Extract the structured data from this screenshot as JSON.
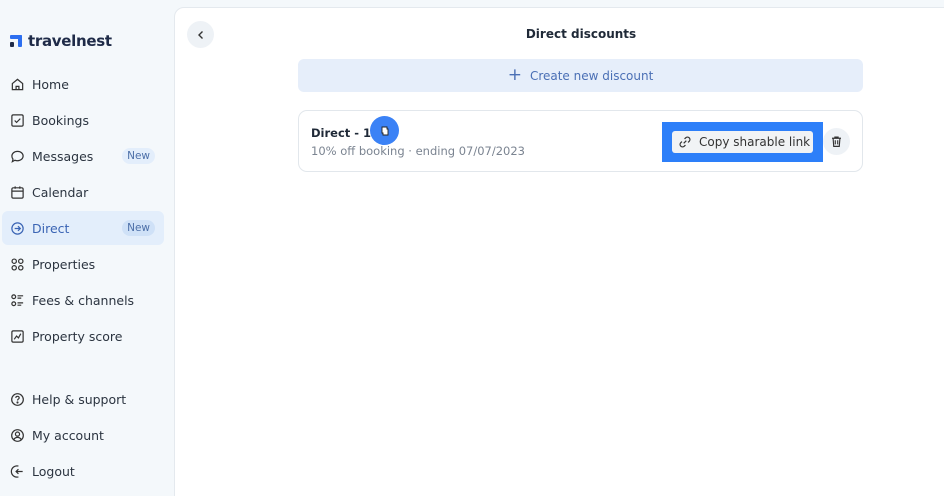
{
  "app": {
    "logo_text": "travelnest",
    "brand_color": "#1f2b48",
    "accent_color": "#3a64b4"
  },
  "sidebar": {
    "items": [
      {
        "label": "Home",
        "icon": "home-icon"
      },
      {
        "label": "Bookings",
        "icon": "checklist-icon"
      },
      {
        "label": "Messages",
        "icon": "chat-bubble-icon",
        "badge": "New"
      },
      {
        "label": "Calendar",
        "icon": "calendar-icon"
      },
      {
        "label": "Direct",
        "icon": "arrow-circle-icon",
        "badge": "New",
        "active": true
      },
      {
        "label": "Properties",
        "icon": "grid-circles-icon"
      },
      {
        "label": "Fees & channels",
        "icon": "list-settings-icon"
      },
      {
        "label": "Property score",
        "icon": "chart-icon"
      },
      {
        "label": "Help & support",
        "icon": "help-circle-icon"
      },
      {
        "label": "My account",
        "icon": "user-circle-icon"
      },
      {
        "label": "Logout",
        "icon": "logout-icon"
      }
    ]
  },
  "main": {
    "title": "Direct discounts",
    "create_label": "Create new discount",
    "discounts": [
      {
        "title": "Direct - 10",
        "subtitle": "10% off booking · ending 07/07/2023",
        "copy_label": "Copy sharable link"
      }
    ]
  }
}
